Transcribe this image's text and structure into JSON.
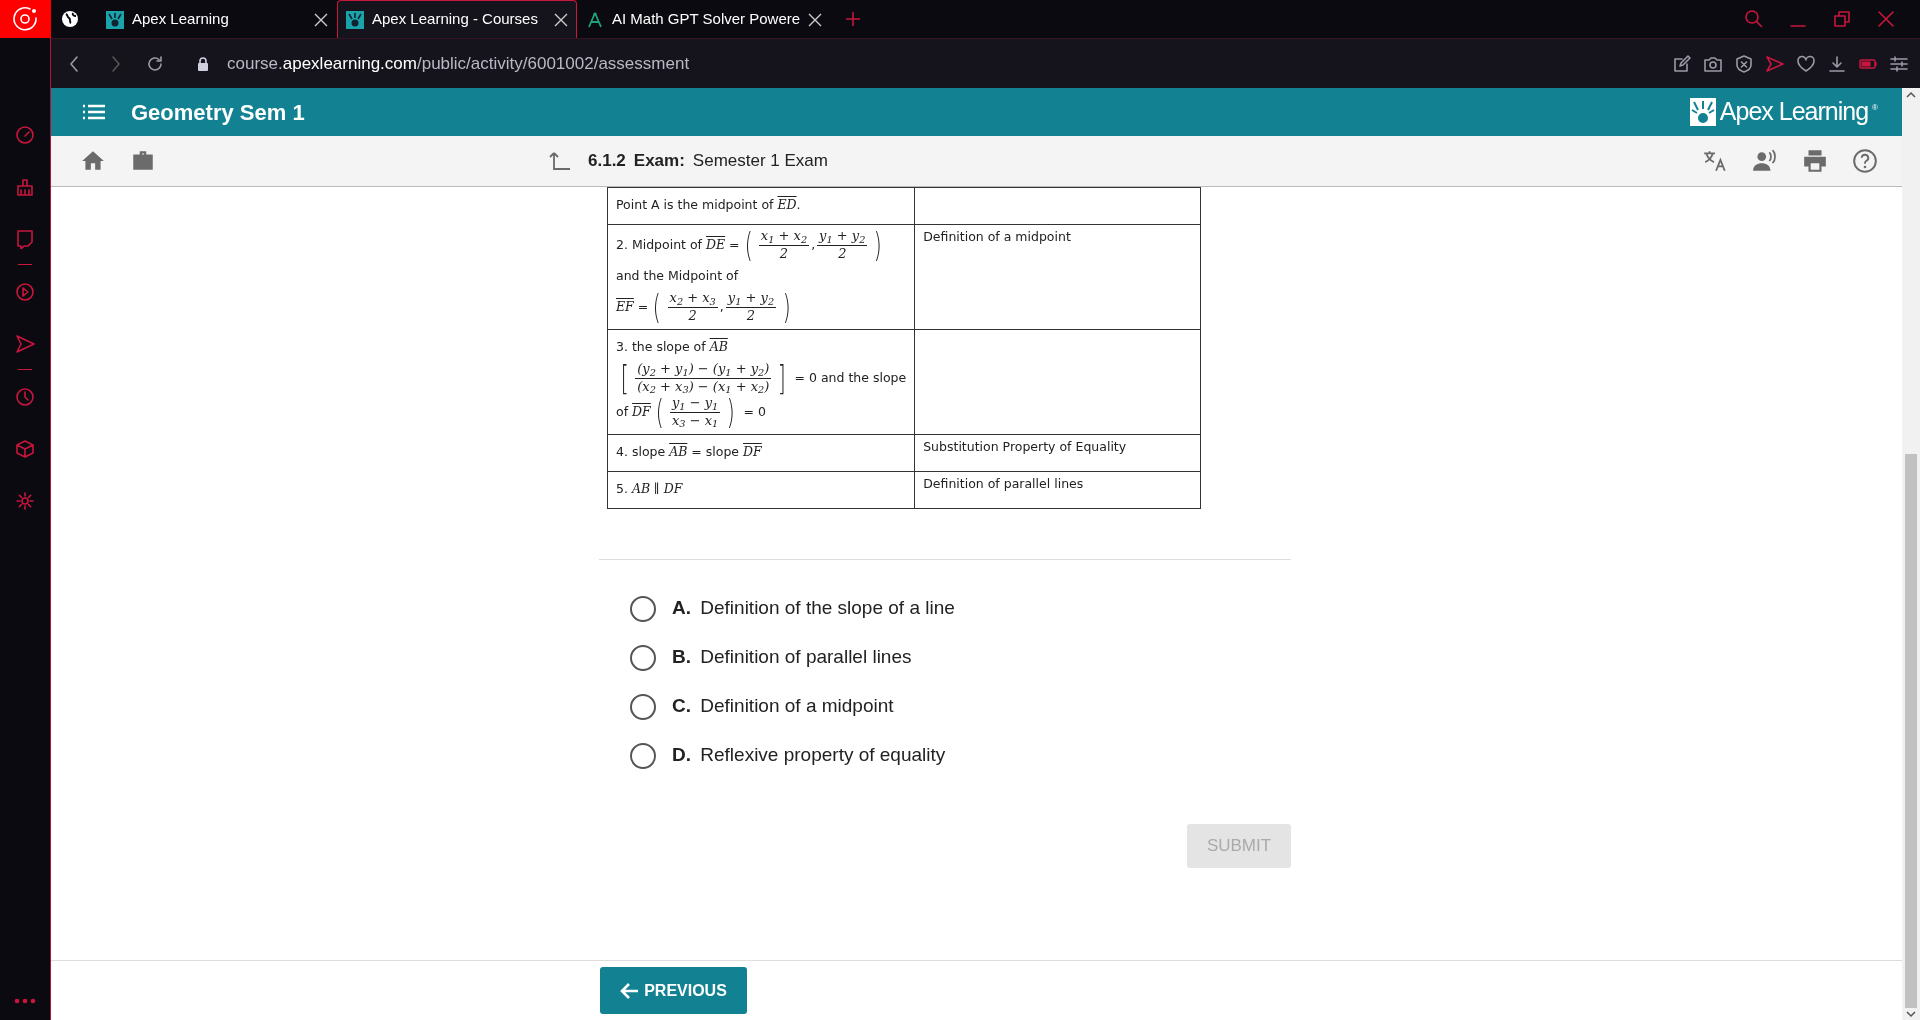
{
  "browser": {
    "tabs": [
      {
        "title": "Apex Learning",
        "selected": false,
        "kind": "apex"
      },
      {
        "title": "Apex Learning - Courses",
        "selected": true,
        "kind": "apex"
      },
      {
        "title": "AI Math GPT Solver Powere",
        "selected": false,
        "kind": "compass"
      }
    ],
    "url": "course.**apexlearning.com**/public/activity/6001002/assessment"
  },
  "header": {
    "course": "Geometry Sem 1",
    "logo": "Apex Learning",
    "logo_mark": "®"
  },
  "toolbar": {
    "number": "6.1.2",
    "type": "Exam:",
    "title": "Semester 1 Exam"
  },
  "proof_table": {
    "rows": [
      {
        "statement": [
          [
            {
              "kind": "text",
              "text": "Point A is the midpoint of "
            },
            {
              "kind": "overline",
              "text": "ED"
            },
            {
              "kind": "text",
              "text": "."
            }
          ]
        ]
      },
      {
        "statement": [
          [
            {
              "kind": "text",
              "text": "2. Midpoint of "
            },
            {
              "kind": "overline",
              "text": "DE"
            },
            {
              "kind": "text",
              "text": " ="
            },
            {
              "kind": "bracket",
              "text": "("
            },
            {
              "kind": "fraction",
              "num": "x$_{1}$ + x$_{2}$",
              "den": "2"
            },
            {
              "kind": "text",
              "text": ","
            },
            {
              "kind": "fraction",
              "num": "y$_{1}$ + y$_{2}$",
              "den": "2"
            },
            {
              "kind": "bracket",
              "text": ")"
            }
          ],
          [
            {
              "kind": "text",
              "text": "and the Midpoint of"
            }
          ],
          [
            {
              "kind": "overline",
              "text": "EF"
            },
            {
              "kind": "text",
              "text": " ="
            },
            {
              "kind": "bracket",
              "text": "("
            },
            {
              "kind": "fraction",
              "num": "x$_{2}$ + x$_{3}$",
              "den": "2"
            },
            {
              "kind": "text",
              "text": ","
            },
            {
              "kind": "fraction",
              "num": "y$_{1}$ + y$_{2}$",
              "den": "2"
            },
            {
              "kind": "bracket",
              "text": ")"
            }
          ]
        ],
        "reason": "Definition of a midpoint"
      },
      {
        "statement": [
          [
            {
              "kind": "text",
              "text": "3. the slope of "
            },
            {
              "kind": "overline",
              "text": "AB"
            }
          ],
          [
            {
              "kind": "bracket",
              "text": "["
            },
            {
              "kind": "fraction",
              "num": "(y$_{2}$ + y$_{1}$) − (y$_{1}$ + y$_{2}$)",
              "den": "(x$_{2}$ + x$_{3}$) − (x$_{1}$ + x$_{2}$)"
            },
            {
              "kind": "bracket",
              "text": "]"
            },
            {
              "kind": "text",
              "text": " = 0 and the slope"
            }
          ],
          [
            {
              "kind": "text",
              "text": "of "
            },
            {
              "kind": "overline",
              "text": "DF"
            },
            {
              "kind": "bracket",
              "text": "("
            },
            {
              "kind": "fraction",
              "num": "y$_{1}$ − y$_{1}$",
              "den": "x$_{3}$ − x$_{1}$"
            },
            {
              "kind": "bracket",
              "text": ")"
            },
            {
              "kind": "text",
              "text": " = 0"
            }
          ]
        ]
      },
      {
        "statement": [
          [
            {
              "kind": "text",
              "text": "4. slope "
            },
            {
              "kind": "overline",
              "text": "AB"
            },
            {
              "kind": "text",
              "text": " = slope "
            },
            {
              "kind": "overline",
              "text": "DF"
            }
          ]
        ],
        "reason": "Substitution Property of Equality"
      },
      {
        "statement": [
          [
            {
              "kind": "text",
              "text": "5. "
            },
            {
              "kind": "italic",
              "text": "AB ∥ DF"
            }
          ]
        ],
        "reason": "Definition of parallel lines"
      }
    ]
  },
  "options": [
    {
      "letter": "A.",
      "text": "Definition of the slope of a line",
      "selected": false
    },
    {
      "letter": "B.",
      "text": "Definition of parallel lines",
      "selected": false
    },
    {
      "letter": "C.",
      "text": "Definition of a midpoint",
      "selected": false
    },
    {
      "letter": "D.",
      "text": "Reflexive property of equality",
      "selected": false
    }
  ],
  "submit": {
    "label": "SUBMIT",
    "disabled": true
  },
  "previous": {
    "label": "PREVIOUS"
  }
}
